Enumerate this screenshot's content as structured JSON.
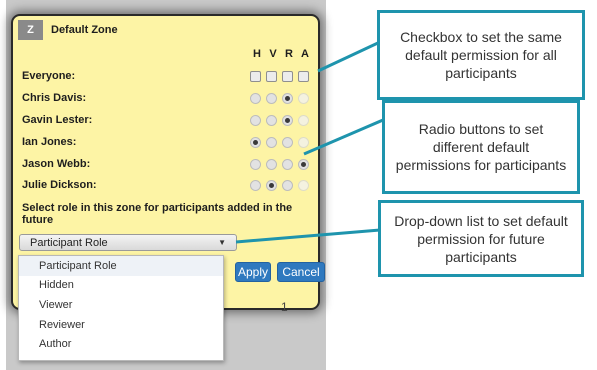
{
  "zone": {
    "badge": "Z",
    "title": "Default Zone",
    "columns": [
      "H",
      "V",
      "R",
      "A"
    ]
  },
  "participants": [
    {
      "name": "Everyone:",
      "control": "checkbox",
      "states": [
        "unchecked",
        "unchecked",
        "unchecked",
        "unchecked"
      ]
    },
    {
      "name": "Chris Davis:",
      "control": "radio",
      "states": [
        "off",
        "off",
        "on",
        "disabled"
      ]
    },
    {
      "name": "Gavin Lester:",
      "control": "radio",
      "states": [
        "off",
        "off",
        "on",
        "disabled"
      ]
    },
    {
      "name": "Ian Jones:",
      "control": "radio",
      "states": [
        "on",
        "off",
        "off",
        "disabled"
      ]
    },
    {
      "name": "Jason Webb:",
      "control": "radio",
      "states": [
        "off",
        "off",
        "off",
        "on"
      ]
    },
    {
      "name": "Julie Dickson:",
      "control": "radio",
      "states": [
        "off",
        "on",
        "off",
        "disabled"
      ]
    }
  ],
  "role_prompt": "Select role in this zone for participants added in the future",
  "role_select": {
    "value": "Participant Role",
    "options": [
      "Participant Role",
      "Hidden",
      "Viewer",
      "Reviewer",
      "Author"
    ]
  },
  "buttons": {
    "apply": "Apply",
    "cancel": "Cancel"
  },
  "page_number": "1",
  "callouts": {
    "checkbox": "Checkbox to set the same default permission for all participants",
    "radio": "Radio buttons to set different default permissions for participants",
    "dropdown": "Drop-down list to set default permission for future participants"
  },
  "colors": {
    "panel": "#fdf4a5",
    "accent": "#1e94ad",
    "button": "#2f79bf"
  }
}
